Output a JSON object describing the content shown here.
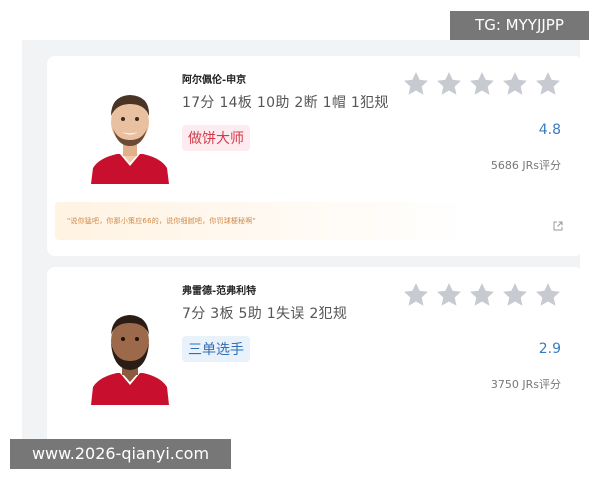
{
  "watermarks": {
    "top_right": "TG: MYYJJPP",
    "bottom_left": "www.2026-qianyi.com"
  },
  "cards": [
    {
      "player_name": "阿尔佩伦-申京",
      "stats": "17分 14板 10助 2断 1帽 1犯规",
      "tag": "做饼大师",
      "tag_color": "#d23a4a",
      "score": "4.8",
      "ratings_count": "5686 JRs评分",
      "comment": "\"说你猛吧，你那小策应66的，说你细腻吧，你罚球梗秘啊\"",
      "stars_total": 5
    },
    {
      "player_name": "弗雷德-范弗利特",
      "stats": "7分 3板 5助 1失误 2犯规",
      "tag": "三单选手",
      "tag_color": "#2f6fb8",
      "score": "2.9",
      "ratings_count": "3750 JRs评分",
      "stars_total": 5
    }
  ],
  "colors": {
    "jersey_red": "#c8102e",
    "star_gray": "#c7cad1",
    "score_blue": "#3a7cc2"
  }
}
